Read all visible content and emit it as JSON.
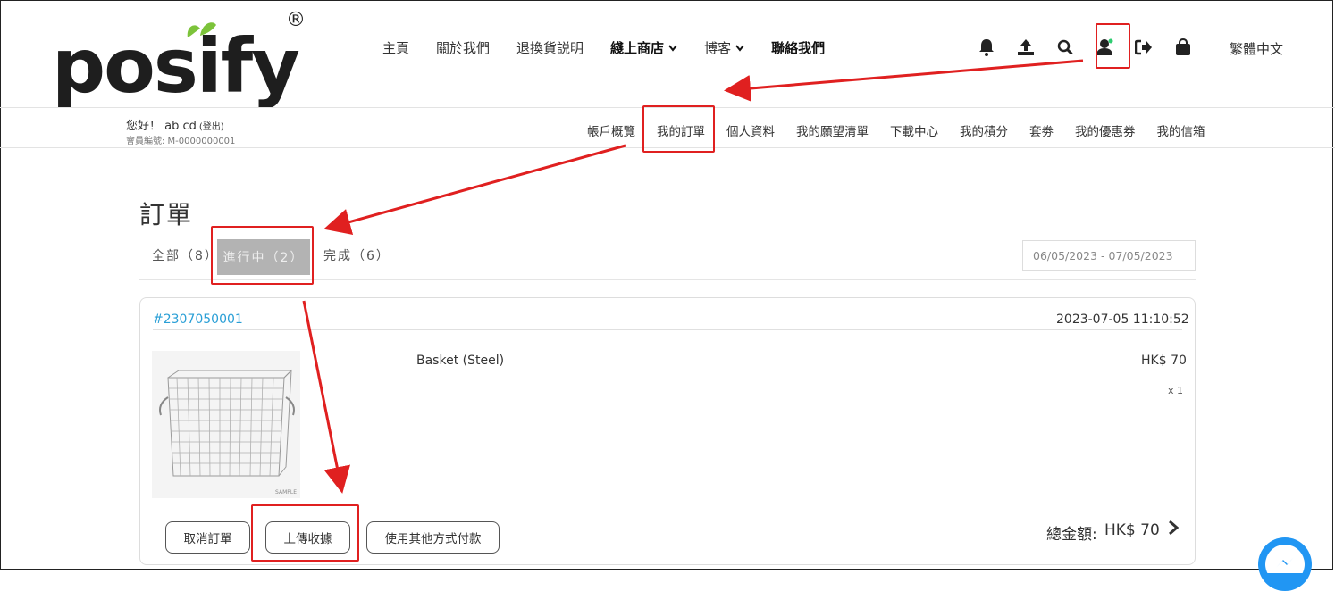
{
  "brand": {
    "logo_text": "posify",
    "registered_mark": "®"
  },
  "nav": {
    "items": [
      {
        "label": "主頁",
        "bold": false,
        "dropdown": false
      },
      {
        "label": "關於我們",
        "bold": false,
        "dropdown": false
      },
      {
        "label": "退換貨説明",
        "bold": false,
        "dropdown": false
      },
      {
        "label": "綫上商店",
        "bold": true,
        "dropdown": true
      },
      {
        "label": "博客",
        "bold": false,
        "dropdown": true
      },
      {
        "label": "聯絡我們",
        "bold": true,
        "dropdown": false
      }
    ],
    "icons": [
      "bell-icon",
      "upload-icon",
      "search-icon",
      "user-icon",
      "logout-icon",
      "shopping-bag-icon"
    ],
    "language": "繁體中文"
  },
  "account": {
    "greeting": "您好！ ab cd",
    "logout": "(登出)",
    "member_no": "會員編號: M-0000000001"
  },
  "subnav": {
    "items": [
      "帳戶概覽",
      "我的訂單",
      "個人資料",
      "我的願望清單",
      "下載中心",
      "我的積分",
      "套劵",
      "我的優惠券",
      "我的信箱"
    ]
  },
  "orders": {
    "title": "訂單",
    "tabs": {
      "all": "全部（8）",
      "in_progress": "進行中（2）",
      "done": "完成（6）"
    },
    "date_range": "06/05/2023 - 07/05/2023",
    "order": {
      "number": "#2307050001",
      "time": "2023-07-05 11:10:52",
      "product_name": "Basket (Steel)",
      "price": "HK$ 70",
      "qty": "x 1",
      "image_watermark": "SAMPLE",
      "buttons": {
        "cancel": "取消訂單",
        "upload": "上傳收據",
        "other_pay": "使用其他方式付款"
      },
      "total_label": "總金額:",
      "total_value": "HK$ 70"
    }
  },
  "colors": {
    "link": "#2a9fd6",
    "highlight": "#e02020",
    "active_tab": "#b3b3b3",
    "leaf": "#7cc33a",
    "messenger": "#2196f3"
  }
}
